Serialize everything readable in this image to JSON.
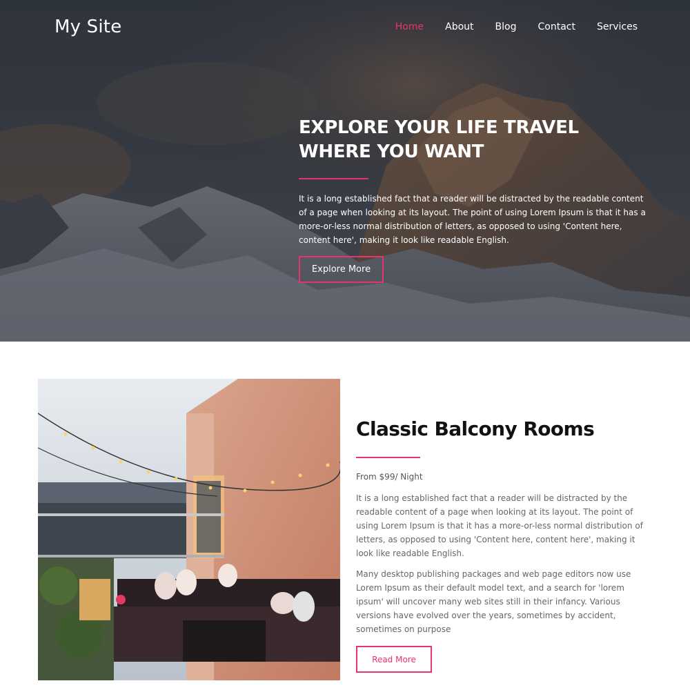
{
  "site": {
    "logo": "My Site"
  },
  "nav": {
    "items": [
      {
        "label": "Home",
        "active": true
      },
      {
        "label": "About",
        "active": false
      },
      {
        "label": "Blog",
        "active": false
      },
      {
        "label": "Contact",
        "active": false
      },
      {
        "label": "Services",
        "active": false
      }
    ]
  },
  "hero": {
    "title": "EXPLORE YOUR LIFE TRAVEL WHERE YOU WANT",
    "text": "It is a long established fact that a reader will be distracted by the readable content of a page when looking at its layout. The point of using Lorem Ipsum is that it has a more-or-less normal distribution of letters, as opposed to using 'Content here, content here', making it look like readable English.",
    "button_label": "Explore More",
    "background_image": "snowy-mountain-photo"
  },
  "room": {
    "title": "Classic Balcony Rooms",
    "price": "From $99/ Night",
    "paragraph_1": "It is a long established fact that a reader will be distracted by the readable content of a page when looking at its layout. The point of using Lorem Ipsum is that it has a more-or-less normal distribution of letters, as opposed to using 'Content here, content here', making it look like readable English.",
    "paragraph_2": "Many desktop publishing packages and web page editors now use Lorem Ipsum as their default model text, and a search for 'lorem ipsum' will uncover many web sites still in their infancy. Various versions have evolved over the years, sometimes by accident, sometimes on purpose",
    "button_label": "Read More",
    "image": "balcony-lounge-photo"
  },
  "colors": {
    "accent": "#e8336b",
    "hero_overlay": "#2a2f38",
    "heading": "#111111",
    "body_text": "#666666"
  }
}
